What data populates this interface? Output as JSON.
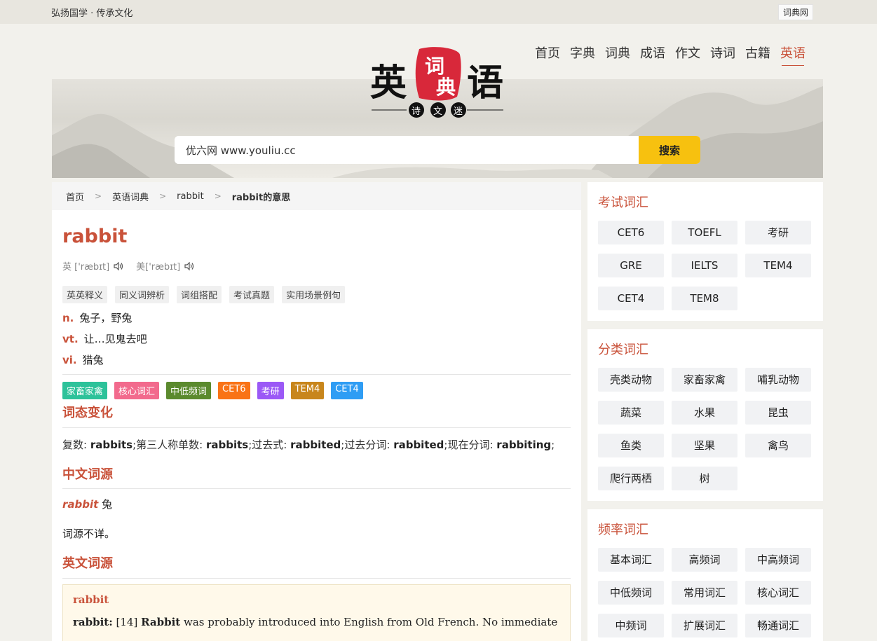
{
  "topbar": {
    "slogan": "弘扬国学 · 传承文化",
    "site_link": "词典网"
  },
  "logo": {
    "chars": [
      "英",
      "词",
      "典",
      "语"
    ],
    "sub": [
      "诗",
      "文",
      "迷"
    ]
  },
  "nav": {
    "items": [
      "首页",
      "字典",
      "词典",
      "成语",
      "作文",
      "诗词",
      "古籍",
      "英语"
    ],
    "active": "英语"
  },
  "search": {
    "value": "优六网 www.youliu.cc",
    "button": "搜索"
  },
  "breadcrumb": [
    "首页",
    "英语词典",
    "rabbit",
    "rabbit的意思"
  ],
  "entry": {
    "word": "rabbit",
    "phonetic_uk": "英 ['ræbɪt]",
    "phonetic_us": "美['ræbɪt]",
    "tabs": [
      "英英释义",
      "同义词辨析",
      "词组搭配",
      "考试真题",
      "实用场景例句"
    ],
    "definitions": [
      {
        "pos": "n.",
        "text": "兔子，野兔"
      },
      {
        "pos": "vt.",
        "text": "让…见鬼去吧"
      },
      {
        "pos": "vi.",
        "text": "猎兔"
      }
    ],
    "badges": [
      {
        "label": "家畜家禽",
        "color": "#2dc29a"
      },
      {
        "label": "核心词汇",
        "color": "#f26a8d"
      },
      {
        "label": "中低频词",
        "color": "#5b8a2e"
      },
      {
        "label": "CET6",
        "color": "#f97316"
      },
      {
        "label": "考研",
        "color": "#9b59f6"
      },
      {
        "label": "TEM4",
        "color": "#c8861c"
      },
      {
        "label": "CET4",
        "color": "#2f9df4"
      }
    ],
    "forms_title": "词态变化",
    "forms": [
      {
        "label": "复数: ",
        "value": "rabbits",
        "sep": ";"
      },
      {
        "label": "第三人称单数: ",
        "value": "rabbits",
        "sep": ";"
      },
      {
        "label": "过去式: ",
        "value": "rabbited",
        "sep": ";"
      },
      {
        "label": "过去分词: ",
        "value": "rabbited",
        "sep": ";"
      },
      {
        "label": "现在分词: ",
        "value": "rabbiting",
        "sep": ";"
      }
    ],
    "cn_ety_title": "中文词源",
    "cn_ety_word": "rabbit",
    "cn_ety_meaning": " 兔",
    "cn_ety_note": "词源不详。",
    "en_ety_title": "英文词源",
    "en_ety_box_title": "rabbit",
    "en_ety_lead": "rabbit:",
    "en_ety_num": " [14] ",
    "en_ety_bold": "Rabbit",
    "en_ety_text": " was probably introduced into English from Old French. No immediate"
  },
  "sidebar": [
    {
      "title": "考试词汇",
      "items": [
        "CET6",
        "TOEFL",
        "考研",
        "GRE",
        "IELTS",
        "TEM4",
        "CET4",
        "TEM8"
      ]
    },
    {
      "title": "分类词汇",
      "items": [
        "壳类动物",
        "家畜家禽",
        "哺乳动物",
        "蔬菜",
        "水果",
        "昆虫",
        "鱼类",
        "坚果",
        "禽鸟",
        "爬行两栖",
        "树"
      ]
    },
    {
      "title": "频率词汇",
      "items": [
        "基本词汇",
        "高频词",
        "中高频词",
        "中低频词",
        "常用词汇",
        "核心词汇",
        "中频词",
        "扩展词汇",
        "畅通词汇"
      ]
    }
  ],
  "colors": {
    "accent": "#c9523a",
    "search_button": "#f7c10f",
    "logo_red": "#d8283a"
  }
}
